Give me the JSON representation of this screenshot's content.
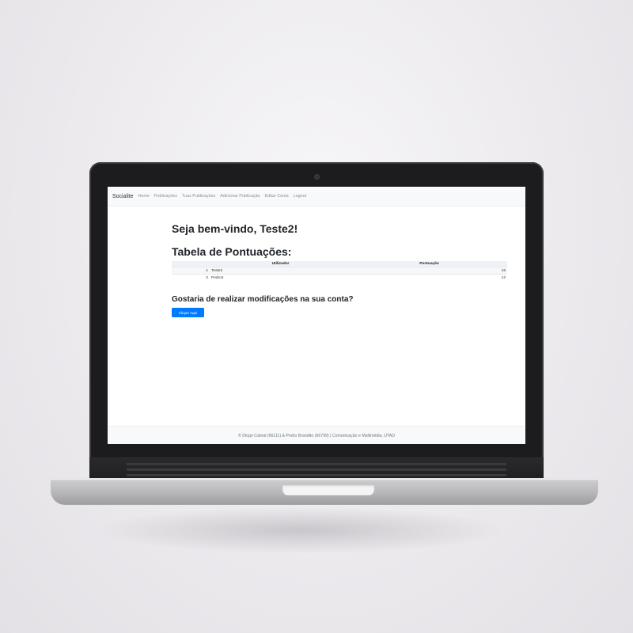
{
  "navbar": {
    "brand": "Socialite",
    "links": [
      "Home",
      "Publicações",
      "Tuas Publicações",
      "Adicionar Publicação",
      "Editar Conta",
      "Logout"
    ]
  },
  "main": {
    "welcome": "Seja bem-vindo, Teste2!",
    "table_title": "Tabela de Pontuações:",
    "table": {
      "columns": [
        "",
        "Utilizador",
        "Pontuação"
      ],
      "rows": [
        {
          "rank": "1",
          "user": "Teste2",
          "score": "15"
        },
        {
          "rank": "2",
          "user": "Pedro2",
          "score": "12"
        }
      ]
    },
    "question": "Gostaria de realizar modificações na sua conta?",
    "button_label": "Clique Aqui"
  },
  "footer": {
    "text": "© Diogo Cabral (66111) & Pedro Brandão (66799) | Comunicação e Multimédia, UTAD"
  },
  "colors": {
    "primary": "#007bff",
    "navbar_bg": "#f8f9fa",
    "laptop_bezel": "#1c1c1e"
  }
}
